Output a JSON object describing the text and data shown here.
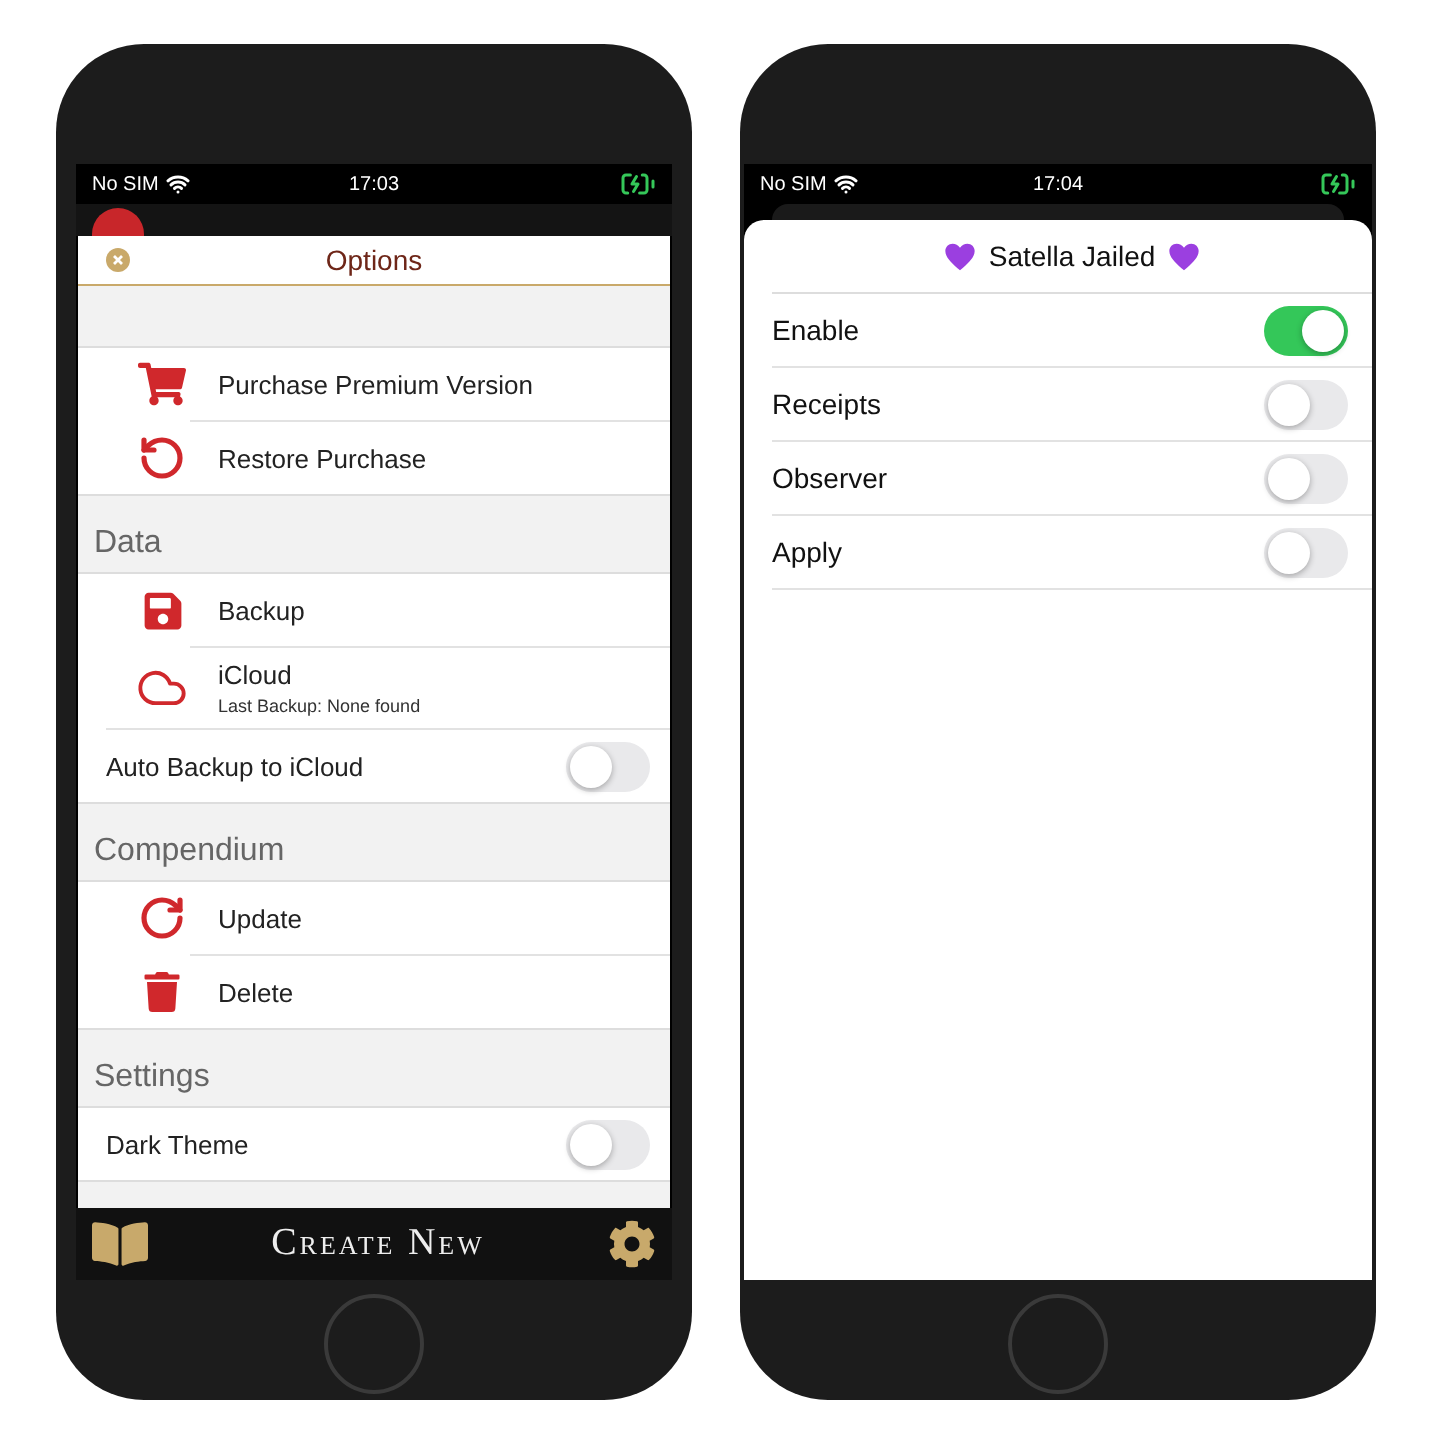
{
  "options_screen": {
    "status_bar": {
      "carrier": "No SIM",
      "time": "17:03"
    },
    "title": "Options",
    "sections": [
      {
        "rows": [
          {
            "kind": "icon",
            "label": "Purchase Premium Version"
          },
          {
            "kind": "icon",
            "label": "Restore Purchase"
          }
        ]
      },
      {
        "header": "Data",
        "rows": [
          {
            "kind": "icon",
            "label": "Backup"
          },
          {
            "kind": "icon",
            "label": "iCloud",
            "subtitle": "Last Backup: None found"
          },
          {
            "kind": "toggle",
            "label": "Auto Backup to iCloud",
            "on": false
          }
        ]
      },
      {
        "header": "Compendium",
        "rows": [
          {
            "kind": "icon",
            "label": "Update"
          },
          {
            "kind": "icon",
            "label": "Delete"
          }
        ]
      },
      {
        "header": "Settings",
        "rows": [
          {
            "kind": "toggle",
            "label": "Dark Theme",
            "on": false
          }
        ]
      }
    ],
    "tab_bar": {
      "label": "Create New"
    }
  },
  "tweak_screen": {
    "status_bar": {
      "carrier": "No SIM",
      "time": "17:04"
    },
    "title": "Satella Jailed",
    "rows": [
      {
        "label": "Enable",
        "on": true
      },
      {
        "label": "Receipts",
        "on": false
      },
      {
        "label": "Observer",
        "on": false
      },
      {
        "label": "Apply",
        "on": false
      }
    ]
  }
}
